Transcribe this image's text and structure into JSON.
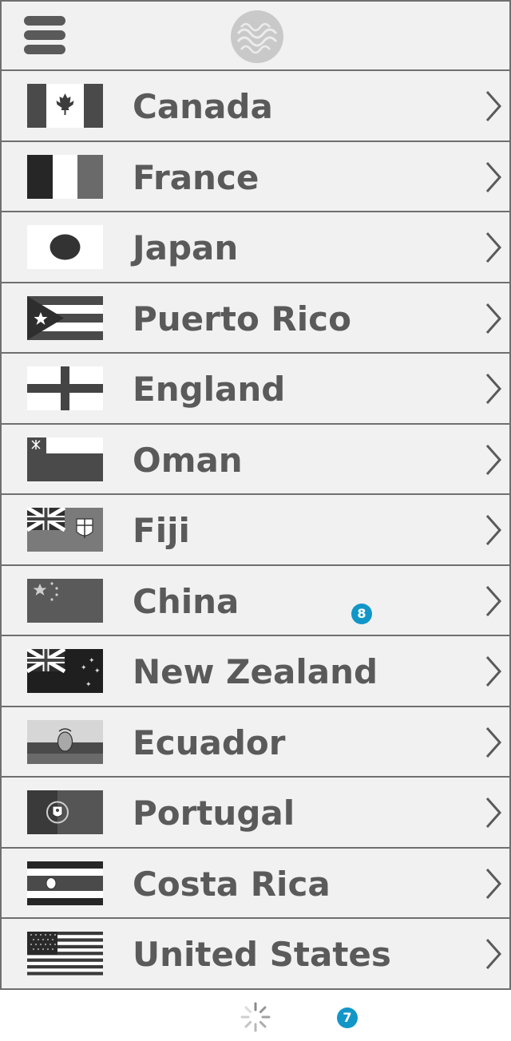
{
  "header": {
    "menu_icon": "hamburger-icon",
    "logo_icon": "wave-emblem-logo"
  },
  "countries": [
    {
      "name": "Canada",
      "flag": "flag-canada-icon"
    },
    {
      "name": "France",
      "flag": "flag-france-icon"
    },
    {
      "name": "Japan",
      "flag": "flag-japan-icon"
    },
    {
      "name": "Puerto Rico",
      "flag": "flag-puerto-rico-icon"
    },
    {
      "name": "England",
      "flag": "flag-england-icon"
    },
    {
      "name": "Oman",
      "flag": "flag-oman-icon"
    },
    {
      "name": "Fiji",
      "flag": "flag-fiji-icon"
    },
    {
      "name": "China",
      "flag": "flag-china-icon"
    },
    {
      "name": "New Zealand",
      "flag": "flag-new-zealand-icon"
    },
    {
      "name": "Ecuador",
      "flag": "flag-ecuador-icon"
    },
    {
      "name": "Portugal",
      "flag": "flag-portugal-icon"
    },
    {
      "name": "Costa Rica",
      "flag": "flag-costa-rica-icon"
    },
    {
      "name": "United States",
      "flag": "flag-united-states-icon"
    }
  ],
  "badges": {
    "china_row": "8",
    "footer": "7"
  },
  "colors": {
    "row_bg": "#f1f1f1",
    "border": "#6f6f6f",
    "text": "#5a5a5a",
    "badge": "#1296c8"
  }
}
